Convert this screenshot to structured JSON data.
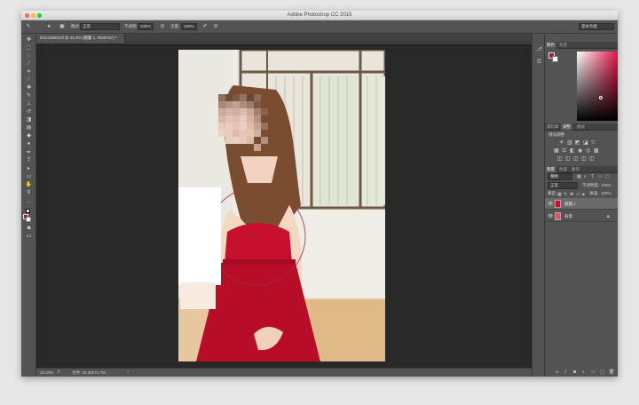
{
  "window": {
    "title": "Adobe Photoshop CC 2015"
  },
  "traffic_lights": [
    {
      "name": "close",
      "color": "#fd5f57"
    },
    {
      "name": "minimize",
      "color": "#febc2e"
    },
    {
      "name": "zoom",
      "color": "#28c840"
    }
  ],
  "options_bar": {
    "mode_label": "模式:",
    "mode_value": "正常",
    "opacity_label": "不透明:",
    "opacity_value": "100%",
    "flow_label": "流量:",
    "flow_value": "100%",
    "workspace": "基本功能"
  },
  "document": {
    "tab_title": "DSC03903.tif @ 33.3% (圖層 1, RGB/16*) *"
  },
  "status_bar": {
    "zoom": "33.33%",
    "doc_size": "文件: 34.3M/71.7M"
  },
  "panels": {
    "color_tabs": [
      "顏色",
      "色票"
    ],
    "adjust_tabs": [
      "資料庫",
      "調整",
      "樣式"
    ],
    "adjust_title": "增加調整",
    "layer_tabs": [
      "圖層",
      "色版",
      "路徑"
    ],
    "filter_value": "種類",
    "blend_mode": "正常",
    "opacity_label": "不透明度:",
    "opacity_value": "100%",
    "lock_label": "鎖定:",
    "fill_label": "填滿:",
    "fill_value": "100%",
    "layers": [
      {
        "name": "圖層 1",
        "selected": true
      },
      {
        "name": "背景",
        "selected": false
      }
    ]
  },
  "colors": {
    "foreground": "#b0163a",
    "dress": "#c8102e",
    "accent": "#e30036"
  }
}
